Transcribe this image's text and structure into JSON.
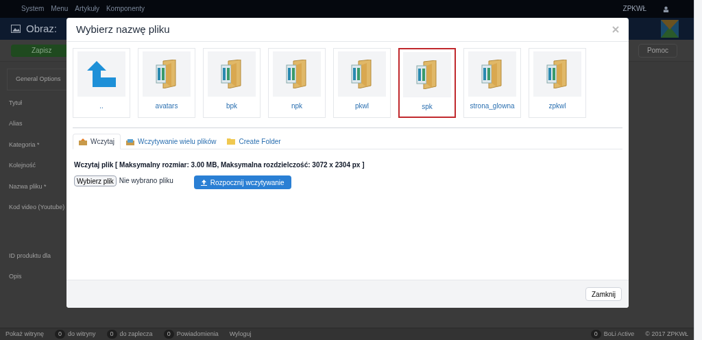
{
  "top_menu": {
    "items": [
      "System",
      "Menu",
      "Artykuły",
      "Komponenty"
    ],
    "site": "ZPKWŁ"
  },
  "header": {
    "title": "Obraz:"
  },
  "toolbar": {
    "save": "Zapisz",
    "help": "Pomoc"
  },
  "form": {
    "tab": "General Options",
    "fields": [
      "Tytuł",
      "Alias",
      "Kategoria *",
      "Kolejność",
      "Nazwa pliku *",
      "Kod video (Youtube)",
      "ID produktu dla",
      "Opis"
    ]
  },
  "status_bar": {
    "items": [
      {
        "kind": "link",
        "label": "Pokaż witrynę"
      },
      {
        "kind": "count",
        "count": "0",
        "label": "do witryny"
      },
      {
        "kind": "count",
        "count": "0",
        "label": "do zaplecza"
      },
      {
        "kind": "count",
        "count": "0",
        "label": "Powiadomienia"
      },
      {
        "kind": "link",
        "label": "Wyloguj"
      }
    ],
    "right": [
      {
        "kind": "count",
        "count": "0",
        "label": "BoLi Active"
      },
      {
        "kind": "text",
        "label": "© 2017 ZPKWŁ"
      }
    ]
  },
  "modal": {
    "title": "Wybierz nazwę pliku",
    "items": [
      {
        "kind": "up",
        "label": "..",
        "selected": false
      },
      {
        "kind": "folder",
        "label": "avatars",
        "selected": false
      },
      {
        "kind": "folder",
        "label": "bpk",
        "selected": false
      },
      {
        "kind": "folder",
        "label": "npk",
        "selected": false
      },
      {
        "kind": "folder",
        "label": "pkwl",
        "selected": false
      },
      {
        "kind": "folder",
        "label": "spk",
        "selected": true
      },
      {
        "kind": "folder",
        "label": "strona_glowna",
        "selected": false
      },
      {
        "kind": "folder",
        "label": "zpkwl",
        "selected": false
      }
    ],
    "tabs": [
      {
        "kind": "upload",
        "label": "Wczytaj",
        "selected": true
      },
      {
        "kind": "multi",
        "label": "Wczytywanie wielu plików",
        "selected": false
      },
      {
        "kind": "folder",
        "label": "Create Folder",
        "selected": false
      }
    ],
    "upload_info": "Wczytaj plik [ Maksymalny rozmiar: 3.00 MB, Maksymalna rozdzielczość: 3072 x 2304 px ]",
    "file_button": "Wybierz plik",
    "file_status": "Nie wybrano pliku",
    "start_button": "Rozpocznij wczytywanie",
    "close_button": "Zamknij"
  }
}
